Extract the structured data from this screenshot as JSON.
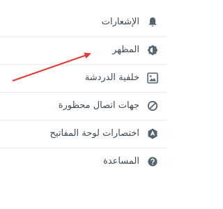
{
  "menu": {
    "items": [
      {
        "id": "notifications",
        "label": "الإشعارات",
        "icon": "bell-icon"
      },
      {
        "id": "theme",
        "label": "المظهر",
        "icon": "theme-icon"
      },
      {
        "id": "chat-wallpaper",
        "label": "خلفية الدردشة",
        "icon": "wallpaper-icon"
      },
      {
        "id": "blocked-contacts",
        "label": "جهات اتصال محظورة",
        "icon": "block-icon"
      },
      {
        "id": "keyboard-shortcuts",
        "label": "اختصارات لوحة المفاتيح",
        "icon": "keyboard-shortcuts-icon"
      },
      {
        "id": "help",
        "label": "المساعدة",
        "icon": "help-icon"
      }
    ]
  },
  "annotation": {
    "arrow_color": "#e53935"
  },
  "colors": {
    "text": "#3b4a54",
    "icon": "#54656f",
    "divider": "#e9edef",
    "background": "#ffffff"
  }
}
